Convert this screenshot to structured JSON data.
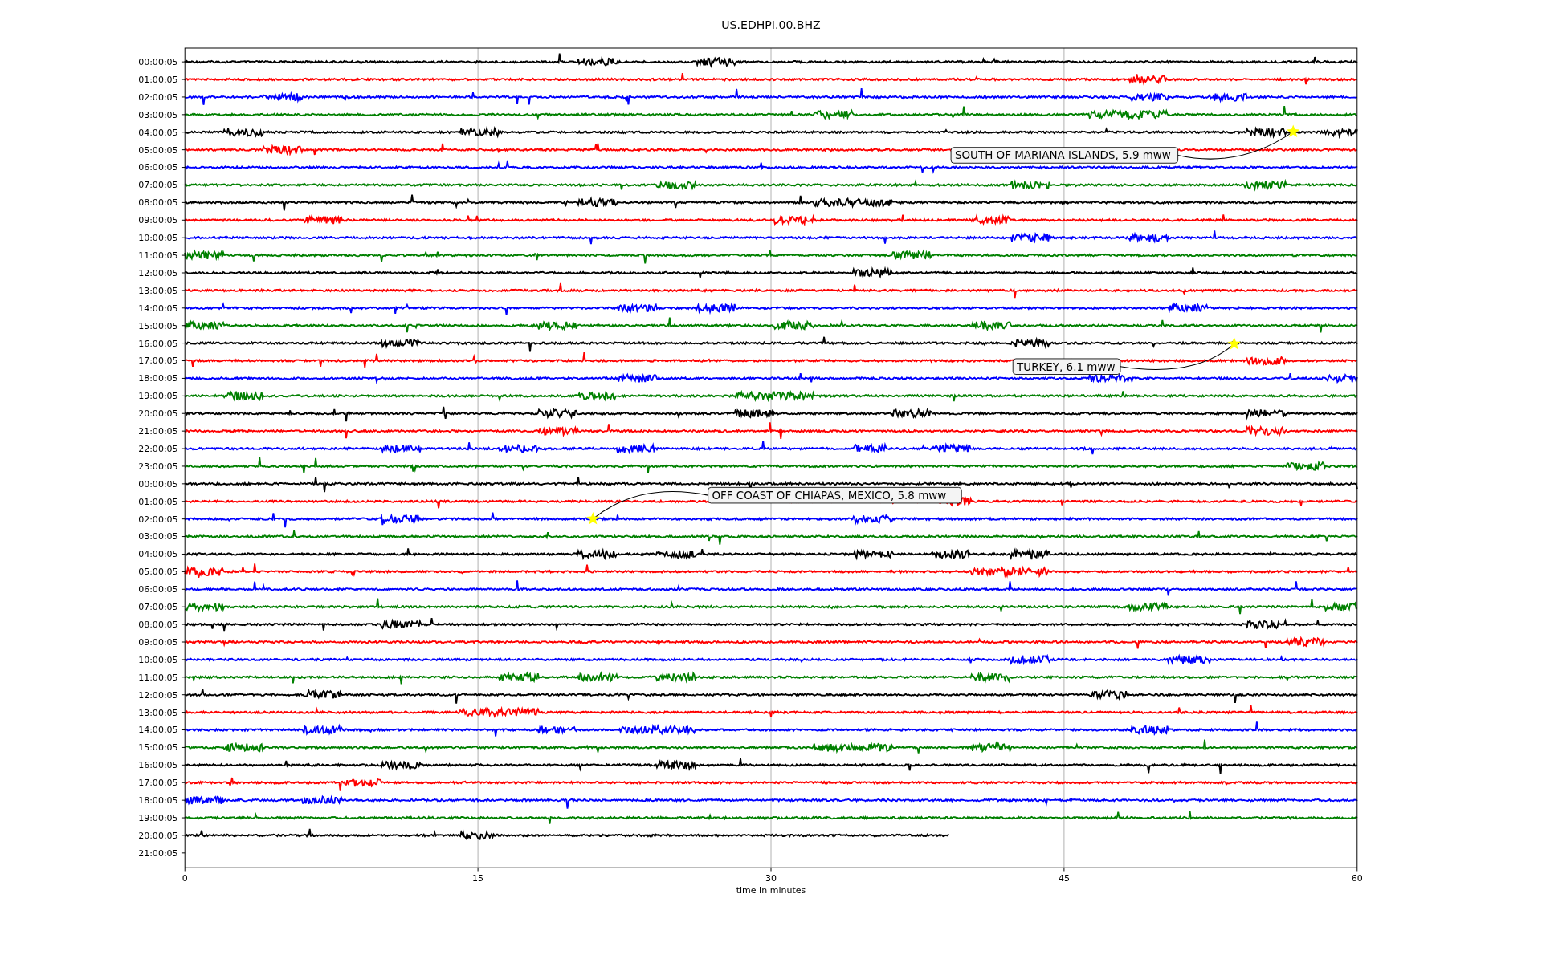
{
  "title": "US.EDHPI.00.BHZ",
  "rows": [
    {
      "label": "00:00:05",
      "color": "#000000",
      "level": 1
    },
    {
      "label": "01:00:05",
      "color": "#ff0000",
      "level": 1
    },
    {
      "label": "02:00:05",
      "color": "#0000ff",
      "level": 1
    },
    {
      "label": "03:00:05",
      "color": "#008000",
      "level": 1
    },
    {
      "label": "04:00:05",
      "color": "#000000",
      "level": 1
    },
    {
      "label": "05:00:05",
      "color": "#ff0000",
      "level": 1
    },
    {
      "label": "06:00:05",
      "color": "#0000ff",
      "level": 1
    },
    {
      "label": "07:00:05",
      "color": "#008000",
      "level": 1
    },
    {
      "label": "08:00:05",
      "color": "#000000",
      "level": 1
    },
    {
      "label": "09:00:05",
      "color": "#ff0000",
      "level": 1
    },
    {
      "label": "10:00:05",
      "color": "#0000ff",
      "level": 1
    },
    {
      "label": "11:00:05",
      "color": "#008000",
      "level": 1
    },
    {
      "label": "12:00:05",
      "color": "#000000",
      "level": 1
    },
    {
      "label": "13:00:05",
      "color": "#ff0000",
      "level": 1
    },
    {
      "label": "14:00:05",
      "color": "#0000ff",
      "level": 1
    },
    {
      "label": "15:00:05",
      "color": "#008000",
      "level": 1
    },
    {
      "label": "16:00:05",
      "color": "#000000",
      "level": 1
    },
    {
      "label": "17:00:05",
      "color": "#ff0000",
      "level": 1
    },
    {
      "label": "18:00:05",
      "color": "#0000ff",
      "level": 1
    },
    {
      "label": "19:00:05",
      "color": "#008000",
      "level": 1
    },
    {
      "label": "20:00:05",
      "color": "#000000",
      "level": 1
    },
    {
      "label": "21:00:05",
      "color": "#ff0000",
      "level": 1
    },
    {
      "label": "22:00:05",
      "color": "#0000ff",
      "level": 1
    },
    {
      "label": "23:00:05",
      "color": "#008000",
      "level": 1
    },
    {
      "label": "00:00:05",
      "color": "#000000",
      "level": 1
    },
    {
      "label": "01:00:05",
      "color": "#ff0000",
      "level": 1
    },
    {
      "label": "02:00:05",
      "color": "#0000ff",
      "level": 1
    },
    {
      "label": "03:00:05",
      "color": "#008000",
      "level": 1
    },
    {
      "label": "04:00:05",
      "color": "#000000",
      "level": 1
    },
    {
      "label": "05:00:05",
      "color": "#ff0000",
      "level": 1
    },
    {
      "label": "06:00:05",
      "color": "#0000ff",
      "level": 1
    },
    {
      "label": "07:00:05",
      "color": "#008000",
      "level": 1
    },
    {
      "label": "08:00:05",
      "color": "#000000",
      "level": 1
    },
    {
      "label": "09:00:05",
      "color": "#ff0000",
      "level": 1
    },
    {
      "label": "10:00:05",
      "color": "#0000ff",
      "level": 1
    },
    {
      "label": "11:00:05",
      "color": "#008000",
      "level": 1
    },
    {
      "label": "12:00:05",
      "color": "#000000",
      "level": 1
    },
    {
      "label": "13:00:05",
      "color": "#ff0000",
      "level": 1
    },
    {
      "label": "14:00:05",
      "color": "#0000ff",
      "level": 1
    },
    {
      "label": "15:00:05",
      "color": "#008000",
      "level": 1
    },
    {
      "label": "16:00:05",
      "color": "#000000",
      "level": 1
    },
    {
      "label": "17:00:05",
      "color": "#ff0000",
      "level": 1
    },
    {
      "label": "18:00:05",
      "color": "#0000ff",
      "level": 1
    },
    {
      "label": "19:00:05",
      "color": "#008000",
      "level": 1
    },
    {
      "label": "20:00:05",
      "color": "#000000",
      "level": 0.652
    },
    {
      "label": "21:00:05"
    }
  ],
  "x_ticks": [
    "0",
    "15",
    "30",
    "45",
    "60"
  ],
  "xlabel": "time in minutes",
  "annotations": [
    {
      "text": "SOUTH OF MARIANA ISLANDS, 5.9 mww"
    },
    {
      "text": "TURKEY, 6.1 mww"
    },
    {
      "text": "OFF COAST OF CHIAPAS, MEXICO, 5.8 mww"
    }
  ]
}
